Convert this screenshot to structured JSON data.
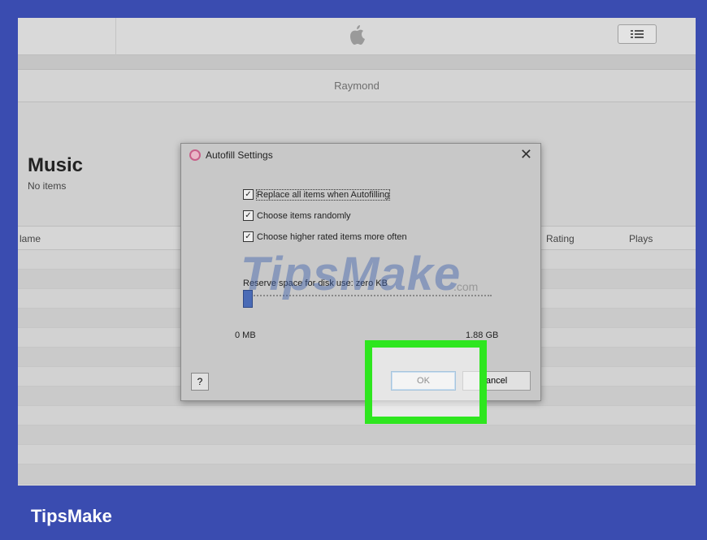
{
  "topbar": {
    "logo_icon": "apple-icon",
    "list_view_icon": "list-view-icon"
  },
  "account": {
    "name": "Raymond"
  },
  "library": {
    "title": "Music",
    "subtitle": "No items",
    "columns": [
      "lame",
      "Rating",
      "Plays"
    ]
  },
  "dialog": {
    "title": "Autofill Settings",
    "close_label": "✕",
    "options": [
      {
        "label": "Replace all items when Autofilling",
        "checked": true
      },
      {
        "label": "Choose items randomly",
        "checked": true
      },
      {
        "label": "Choose higher rated items more often",
        "checked": true
      }
    ],
    "reserve_label": "Reserve space for disk use: zero KB",
    "slider": {
      "min_label": "0 MB",
      "max_label": "1.88 GB",
      "value_fraction": 0.0
    },
    "help_label": "?",
    "ok_label": "OK",
    "cancel_label": "ancel"
  },
  "watermark": {
    "text": "TipsMake",
    "suffix": ".com"
  },
  "footer": {
    "brand": "TipsMake"
  },
  "colors": {
    "frame": "#3a4cb0",
    "highlight": "#2ee61f"
  }
}
